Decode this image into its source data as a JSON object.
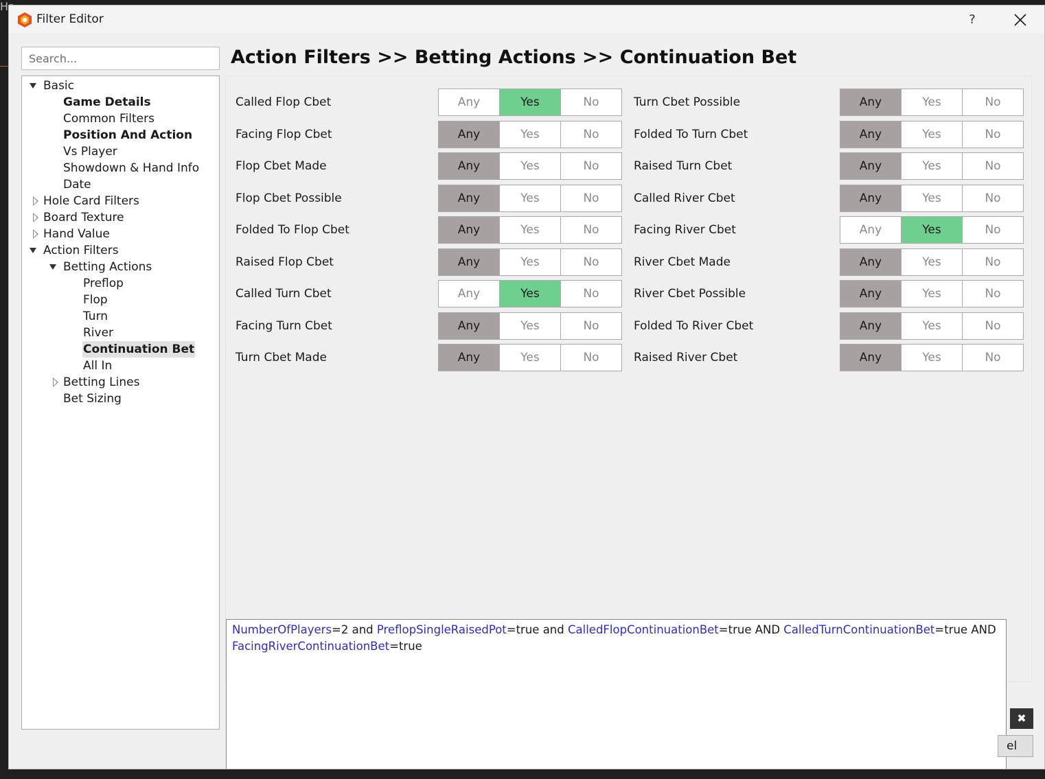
{
  "window": {
    "title": "Filter Editor",
    "help_label": "?",
    "background_peek": "Ha"
  },
  "search": {
    "placeholder": "Search..."
  },
  "tree": {
    "nodes": [
      {
        "label": "Basic",
        "level": 0,
        "arrow": "open",
        "style": "normal"
      },
      {
        "label": "Game Details",
        "level": 1,
        "arrow": "none",
        "style": "bold"
      },
      {
        "label": "Common Filters",
        "level": 1,
        "arrow": "none",
        "style": "normal"
      },
      {
        "label": "Position And Action",
        "level": 1,
        "arrow": "none",
        "style": "bold"
      },
      {
        "label": "Vs Player",
        "level": 1,
        "arrow": "none",
        "style": "normal"
      },
      {
        "label": "Showdown & Hand Info",
        "level": 1,
        "arrow": "none",
        "style": "normal"
      },
      {
        "label": "Date",
        "level": 1,
        "arrow": "none",
        "style": "normal"
      },
      {
        "label": "Hole Card Filters",
        "level": 0,
        "arrow": "closed",
        "style": "normal"
      },
      {
        "label": "Board Texture",
        "level": 0,
        "arrow": "closed",
        "style": "normal"
      },
      {
        "label": "Hand Value",
        "level": 0,
        "arrow": "closed",
        "style": "normal"
      },
      {
        "label": "Action Filters",
        "level": 0,
        "arrow": "open",
        "style": "normal"
      },
      {
        "label": "Betting Actions",
        "level": 1,
        "arrow": "open",
        "style": "normal"
      },
      {
        "label": "Preflop",
        "level": 2,
        "arrow": "none",
        "style": "normal"
      },
      {
        "label": "Flop",
        "level": 2,
        "arrow": "none",
        "style": "normal"
      },
      {
        "label": "Turn",
        "level": 2,
        "arrow": "none",
        "style": "normal"
      },
      {
        "label": "River",
        "level": 2,
        "arrow": "none",
        "style": "normal"
      },
      {
        "label": "Continuation Bet",
        "level": 2,
        "arrow": "none",
        "style": "selected"
      },
      {
        "label": "All In",
        "level": 2,
        "arrow": "none",
        "style": "normal"
      },
      {
        "label": "Betting Lines",
        "level": 1,
        "arrow": "closed",
        "style": "normal"
      },
      {
        "label": "Bet Sizing",
        "level": 1,
        "arrow": "none",
        "style": "normal"
      }
    ]
  },
  "breadcrumb": "Action Filters >> Betting Actions >> Continuation Bet",
  "option_labels": [
    "Any",
    "Yes",
    "No"
  ],
  "filters": {
    "left": [
      {
        "label": "Called Flop Cbet",
        "value": "Yes"
      },
      {
        "label": "Facing Flop Cbet",
        "value": "Any"
      },
      {
        "label": "Flop Cbet Made",
        "value": "Any"
      },
      {
        "label": "Flop Cbet Possible",
        "value": "Any"
      },
      {
        "label": "Folded To Flop Cbet",
        "value": "Any"
      },
      {
        "label": "Raised Flop Cbet",
        "value": "Any"
      },
      {
        "label": "Called Turn Cbet",
        "value": "Yes"
      },
      {
        "label": "Facing Turn Cbet",
        "value": "Any"
      },
      {
        "label": "Turn Cbet Made",
        "value": "Any"
      }
    ],
    "right": [
      {
        "label": "Turn Cbet Possible",
        "value": "Any"
      },
      {
        "label": "Folded To Turn Cbet",
        "value": "Any"
      },
      {
        "label": "Raised Turn Cbet",
        "value": "Any"
      },
      {
        "label": "Called River Cbet",
        "value": "Any"
      },
      {
        "label": "Facing River Cbet",
        "value": "Yes"
      },
      {
        "label": "River Cbet Made",
        "value": "Any"
      },
      {
        "label": "River Cbet Possible",
        "value": "Any"
      },
      {
        "label": "Folded To River Cbet",
        "value": "Any"
      },
      {
        "label": "Raised River Cbet",
        "value": "Any"
      }
    ]
  },
  "expression": [
    {
      "text": "NumberOfPlayers",
      "kw": true
    },
    {
      "text": "=2 and ",
      "kw": false
    },
    {
      "text": "PreflopSingleRaisedPot",
      "kw": true
    },
    {
      "text": "=true and ",
      "kw": false
    },
    {
      "text": "CalledFlopContinuationBet",
      "kw": true
    },
    {
      "text": "=true AND ",
      "kw": false
    },
    {
      "text": "CalledTurnContinuationBet",
      "kw": true
    },
    {
      "text": "=true AND ",
      "kw": false
    },
    {
      "text": "FacingRiverContinuationBet",
      "kw": true
    },
    {
      "text": "=true",
      "kw": false
    }
  ],
  "footer": {
    "clear_glyph": "✖",
    "cancel_fragment": "el"
  },
  "colors": {
    "yes_selected": "#6fcf8f",
    "any_selected": "#a7a1a1",
    "keyword": "#2f2fb4"
  }
}
